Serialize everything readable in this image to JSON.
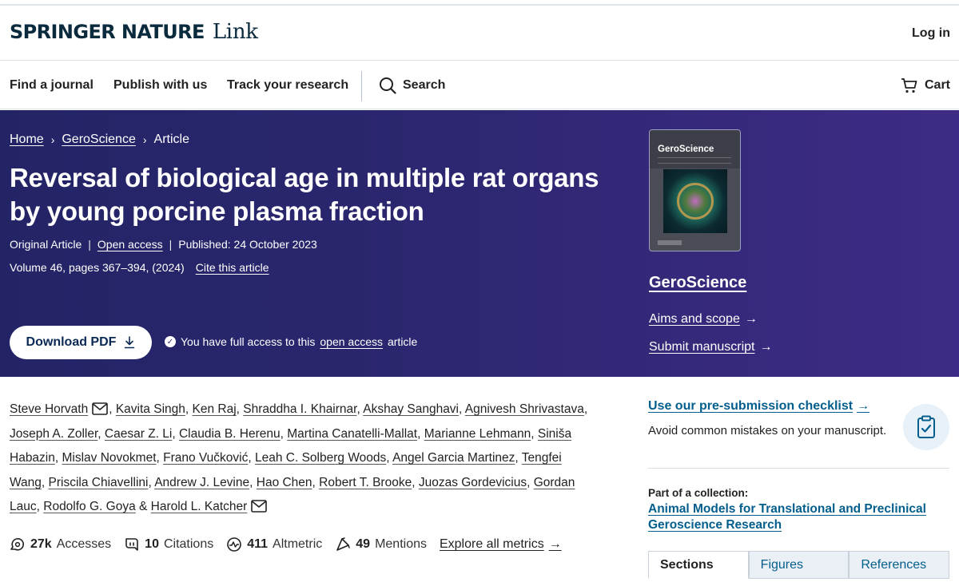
{
  "header": {
    "brand_main": "SPRINGER NATURE",
    "brand_sub": "Link",
    "login": "Log in"
  },
  "nav": {
    "items": [
      "Find a journal",
      "Publish with us",
      "Track your research"
    ],
    "search": "Search",
    "cart": "Cart"
  },
  "breadcrumb": [
    "Home",
    "GeroScience",
    "Article"
  ],
  "article": {
    "title": "Reversal of biological age in multiple rat organs by young porcine plasma fraction",
    "type": "Original Article",
    "access": "Open access",
    "published": "Published: 24 October 2023",
    "volume": "Volume 46, pages 367–394, (2024)",
    "cite": "Cite this article",
    "download": "Download PDF",
    "access_note_prefix": "You have full access to this",
    "access_note_link": "open access",
    "access_note_suffix": "article"
  },
  "journal": {
    "cover_title": "GeroScience",
    "name": "GeroScience",
    "aims": "Aims and scope",
    "submit": "Submit manuscript"
  },
  "authors": {
    "a1": "Steve Horvath",
    "a2": "Kavita Singh",
    "a3": "Ken Raj",
    "a4": "Shraddha I. Khairnar",
    "a5": "Akshay Sanghavi",
    "a6": "Agnivesh Shrivastava",
    "a7": "Joseph A. Zoller",
    "a8": "Caesar Z. Li",
    "a9": "Claudia B. Herenu",
    "a10": "Martina Canatelli-Mallat",
    "a11": "Marianne Lehmann",
    "a12_1": "Siniša",
    "a12_2": "Habazin",
    "a13": "Mislav Novokmet",
    "a14": "Frano Vučković",
    "a15": "Leah C. Solberg Woods",
    "a16": "Angel Garcia Martinez",
    "a17_1": "Tengfei",
    "a17_2": "Wang",
    "a18": "Priscila Chiavellini",
    "a19": "Andrew J. Levine",
    "a20": "Hao Chen",
    "a21": "Robert T. Brooke",
    "a22": "Juozas Gordevicius",
    "a23_1": "Gordan",
    "a23_2": "Lauc",
    "a24": "Rodolfo G. Goya",
    "amp": "&",
    "a25": "Harold L. Katcher"
  },
  "metrics": {
    "accesses_value": "27k",
    "accesses_label": "Accesses",
    "citations_value": "10",
    "citations_label": "Citations",
    "altmetric_value": "411",
    "altmetric_label": "Altmetric",
    "mentions_value": "49",
    "mentions_label": "Mentions",
    "explore": "Explore all metrics"
  },
  "sidebar": {
    "checklist": "Use our pre-submission checklist",
    "checklist_desc": "Avoid common mistakes on your manuscript.",
    "part_label": "Part of a collection:",
    "part_link": "Animal Models for Translational and Preclinical Geroscience Research",
    "tabs": [
      "Sections",
      "Figures",
      "References"
    ]
  },
  "colors": {
    "hero_start": "#232466",
    "hero_end": "#3e2b85",
    "link_blue": "#025e8d",
    "brand_navy": "#0a2a3d"
  }
}
